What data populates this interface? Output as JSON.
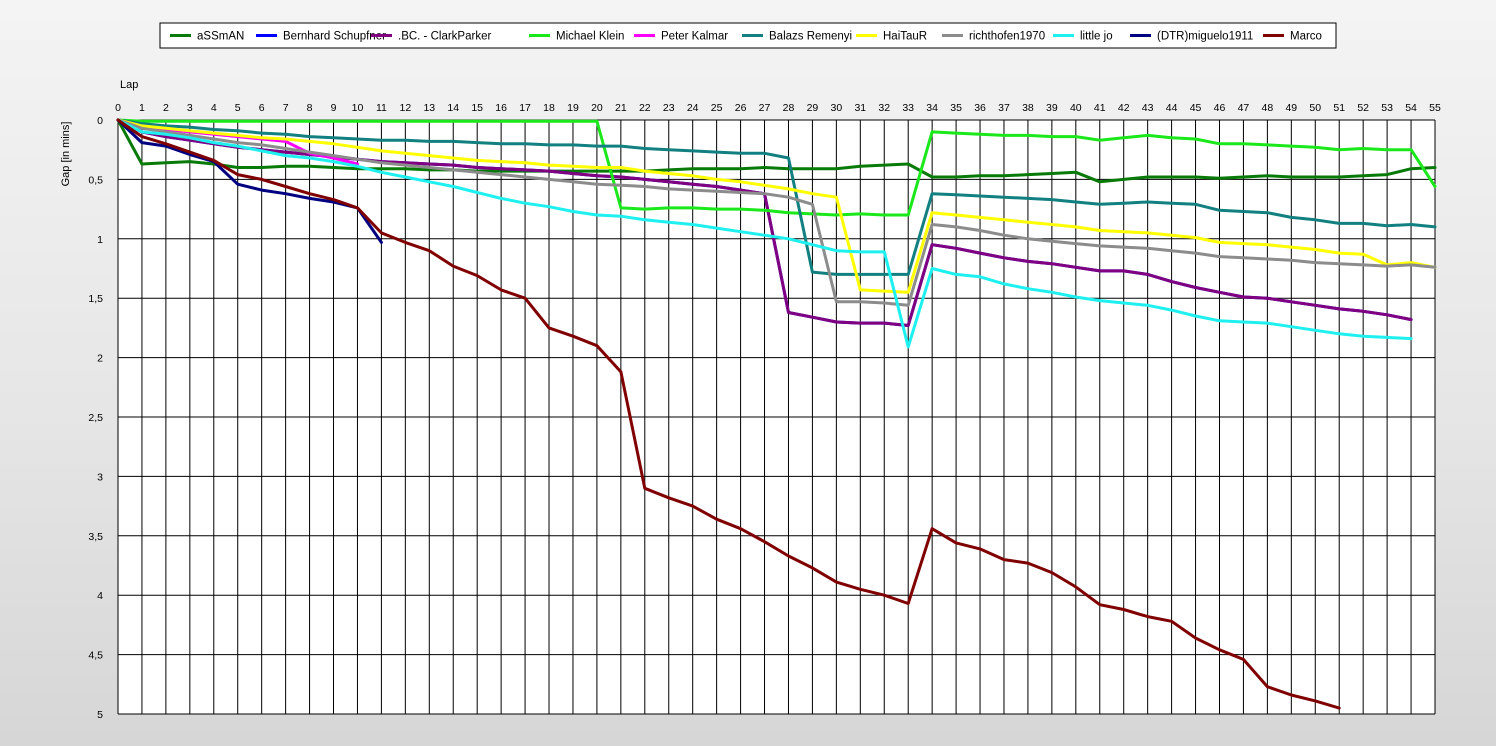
{
  "chart_data": {
    "type": "line",
    "xlabel": "Lap",
    "ylabel": "Gap [in mins]",
    "legend_position": "top",
    "grid": true,
    "y_inverted": true,
    "x_range": [
      0,
      55
    ],
    "y_range": [
      0,
      5
    ],
    "x_ticks": [
      "0",
      "1",
      "2",
      "3",
      "4",
      "5",
      "6",
      "7",
      "8",
      "9",
      "10",
      "11",
      "12",
      "13",
      "14",
      "15",
      "16",
      "17",
      "18",
      "19",
      "20",
      "21",
      "22",
      "23",
      "24",
      "25",
      "26",
      "27",
      "28",
      "29",
      "30",
      "31",
      "32",
      "33",
      "34",
      "35",
      "36",
      "37",
      "38",
      "39",
      "40",
      "41",
      "42",
      "43",
      "44",
      "45",
      "46",
      "47",
      "48",
      "49",
      "50",
      "51",
      "52",
      "53",
      "54",
      "55"
    ],
    "y_ticks": [
      "0",
      "0,5",
      "1",
      "1,5",
      "2",
      "2,5",
      "3",
      "3,5",
      "4",
      "4,5",
      "5"
    ],
    "y_tick_values": [
      0,
      0.5,
      1,
      1.5,
      2,
      2.5,
      3,
      3.5,
      4,
      4.5,
      5
    ],
    "series": [
      {
        "name": "aSSmAN",
        "color": "#087a08",
        "values": [
          0,
          0.37,
          0.36,
          0.35,
          0.37,
          0.4,
          0.4,
          0.39,
          0.39,
          0.4,
          0.41,
          0.41,
          0.41,
          0.42,
          0.42,
          0.43,
          0.43,
          0.43,
          0.43,
          0.43,
          0.43,
          0.43,
          0.43,
          0.42,
          0.41,
          0.41,
          0.41,
          0.4,
          0.41,
          0.41,
          0.41,
          0.39,
          0.38,
          0.37,
          0.48,
          0.48,
          0.47,
          0.47,
          0.46,
          0.45,
          0.44,
          0.52,
          0.5,
          0.48,
          0.48,
          0.48,
          0.49,
          0.48,
          0.47,
          0.48,
          0.48,
          0.48,
          0.47,
          0.46,
          0.41,
          0.4
        ]
      },
      {
        "name": "Bernhard Schupfner",
        "color": "#0000ff",
        "values": [
          0,
          0.1,
          0.14,
          0.17,
          0.2,
          0.23,
          0.25,
          0.27,
          0.29,
          0.31,
          0.33,
          0.35,
          0.36,
          0.37,
          0.38,
          0.4,
          0.41,
          0.42,
          0.43,
          0.45,
          0.47,
          0.48,
          0.5,
          0.52,
          0.54,
          0.56,
          0.59,
          0.62,
          1.62,
          1.66,
          1.7,
          1.71,
          1.71,
          1.73,
          1.05,
          1.08,
          1.12,
          1.16,
          1.19,
          1.21,
          1.24,
          1.27,
          1.27,
          1.3,
          1.36,
          1.41,
          1.45,
          1.49,
          1.5,
          1.53,
          1.56,
          1.59,
          1.61,
          1.64,
          1.68
        ]
      },
      {
        "name": ".BC. - ClarkParker",
        "color": "#800080",
        "values": [
          0,
          0.1,
          0.14,
          0.17,
          0.2,
          0.23,
          0.25,
          0.27,
          0.29,
          0.31,
          0.33,
          0.35,
          0.36,
          0.37,
          0.38,
          0.4,
          0.41,
          0.42,
          0.43,
          0.45,
          0.47,
          0.48,
          0.5,
          0.52,
          0.54,
          0.56,
          0.59,
          0.62,
          1.62,
          1.66,
          1.7,
          1.71,
          1.71,
          1.73,
          1.05,
          1.08,
          1.12,
          1.16,
          1.19,
          1.21,
          1.24,
          1.27,
          1.27,
          1.3,
          1.36,
          1.41,
          1.45,
          1.49,
          1.5,
          1.53,
          1.56,
          1.59,
          1.61,
          1.64,
          1.68
        ]
      },
      {
        "name": "Michael Klein",
        "color": "#1ae81a",
        "values": [
          0,
          0.01,
          0.01,
          0.01,
          0.01,
          0.01,
          0.01,
          0.01,
          0.01,
          0.01,
          0.01,
          0.01,
          0.01,
          0.01,
          0.01,
          0.01,
          0.01,
          0.01,
          0.01,
          0.01,
          0.01,
          0.74,
          0.75,
          0.74,
          0.74,
          0.75,
          0.75,
          0.76,
          0.78,
          0.79,
          0.8,
          0.79,
          0.8,
          0.8,
          0.1,
          0.11,
          0.12,
          0.13,
          0.13,
          0.14,
          0.14,
          0.17,
          0.15,
          0.13,
          0.15,
          0.16,
          0.2,
          0.2,
          0.21,
          0.22,
          0.23,
          0.25,
          0.24,
          0.25,
          0.25,
          0.56
        ]
      },
      {
        "name": "Peter Kalmar",
        "color": "#ff00ff",
        "values": [
          0,
          0.05,
          0.08,
          0.1,
          0.12,
          0.14,
          0.16,
          0.18,
          0.28,
          0.32,
          0.37
        ]
      },
      {
        "name": "Balazs Remenyi",
        "color": "#128080",
        "values": [
          0,
          0.03,
          0.05,
          0.06,
          0.08,
          0.09,
          0.11,
          0.12,
          0.14,
          0.15,
          0.16,
          0.17,
          0.17,
          0.18,
          0.18,
          0.19,
          0.2,
          0.2,
          0.21,
          0.21,
          0.22,
          0.22,
          0.24,
          0.25,
          0.26,
          0.27,
          0.28,
          0.28,
          0.32,
          1.28,
          1.3,
          1.3,
          1.3,
          1.3,
          0.62,
          0.63,
          0.64,
          0.65,
          0.66,
          0.67,
          0.69,
          0.71,
          0.7,
          0.69,
          0.7,
          0.71,
          0.76,
          0.77,
          0.78,
          0.82,
          0.84,
          0.87,
          0.87,
          0.89,
          0.88,
          0.9
        ]
      },
      {
        "name": "HaiTauR",
        "color": "#ffff00",
        "values": [
          0,
          0.05,
          0.07,
          0.09,
          0.11,
          0.13,
          0.15,
          0.16,
          0.18,
          0.2,
          0.23,
          0.26,
          0.28,
          0.3,
          0.32,
          0.34,
          0.35,
          0.36,
          0.38,
          0.39,
          0.4,
          0.4,
          0.43,
          0.45,
          0.47,
          0.5,
          0.52,
          0.55,
          0.58,
          0.62,
          0.65,
          1.43,
          1.44,
          1.45,
          0.78,
          0.8,
          0.82,
          0.84,
          0.86,
          0.88,
          0.9,
          0.93,
          0.94,
          0.95,
          0.97,
          0.99,
          1.03,
          1.04,
          1.05,
          1.07,
          1.09,
          1.12,
          1.13,
          1.22,
          1.2,
          1.24
        ]
      },
      {
        "name": "richthofen1970",
        "color": "#8c8c8c",
        "values": [
          0,
          0.07,
          0.1,
          0.13,
          0.16,
          0.19,
          0.21,
          0.24,
          0.27,
          0.3,
          0.33,
          0.36,
          0.38,
          0.4,
          0.42,
          0.44,
          0.46,
          0.48,
          0.5,
          0.52,
          0.54,
          0.55,
          0.56,
          0.58,
          0.59,
          0.6,
          0.61,
          0.62,
          0.65,
          0.71,
          1.53,
          1.53,
          1.54,
          1.56,
          0.88,
          0.9,
          0.93,
          0.97,
          1.0,
          1.02,
          1.04,
          1.06,
          1.07,
          1.08,
          1.1,
          1.12,
          1.15,
          1.16,
          1.17,
          1.18,
          1.2,
          1.21,
          1.22,
          1.23,
          1.22,
          1.24
        ]
      },
      {
        "name": "little jo",
        "color": "#1ef0f0",
        "values": [
          0,
          0.1,
          0.12,
          0.15,
          0.19,
          0.22,
          0.26,
          0.3,
          0.32,
          0.35,
          0.39,
          0.44,
          0.48,
          0.52,
          0.56,
          0.61,
          0.66,
          0.7,
          0.73,
          0.77,
          0.8,
          0.81,
          0.84,
          0.86,
          0.88,
          0.91,
          0.94,
          0.97,
          1.0,
          1.05,
          1.1,
          1.11,
          1.11,
          1.91,
          1.25,
          1.3,
          1.32,
          1.38,
          1.42,
          1.45,
          1.49,
          1.52,
          1.54,
          1.56,
          1.6,
          1.65,
          1.69,
          1.7,
          1.71,
          1.74,
          1.77,
          1.8,
          1.82,
          1.83,
          1.84
        ]
      },
      {
        "name": "(DTR)miguelo1911",
        "color": "#000080",
        "values": [
          0,
          0.19,
          0.22,
          0.29,
          0.35,
          0.54,
          0.59,
          0.62,
          0.66,
          0.69,
          0.74,
          1.03
        ]
      },
      {
        "name": "Marco",
        "color": "#800000",
        "values": [
          0,
          0.14,
          0.2,
          0.27,
          0.34,
          0.46,
          0.5,
          0.56,
          0.62,
          0.67,
          0.74,
          0.95,
          1.03,
          1.1,
          1.23,
          1.31,
          1.43,
          1.5,
          1.75,
          1.82,
          1.9,
          2.12,
          3.1,
          3.18,
          3.25,
          3.36,
          3.44,
          3.55,
          3.67,
          3.77,
          3.89,
          3.95,
          4.0,
          4.07,
          3.44,
          3.56,
          3.61,
          3.7,
          3.73,
          3.81,
          3.93,
          4.08,
          4.12,
          4.18,
          4.22,
          4.36,
          4.46,
          4.54,
          4.77,
          4.84,
          4.89,
          4.95
        ]
      }
    ]
  }
}
